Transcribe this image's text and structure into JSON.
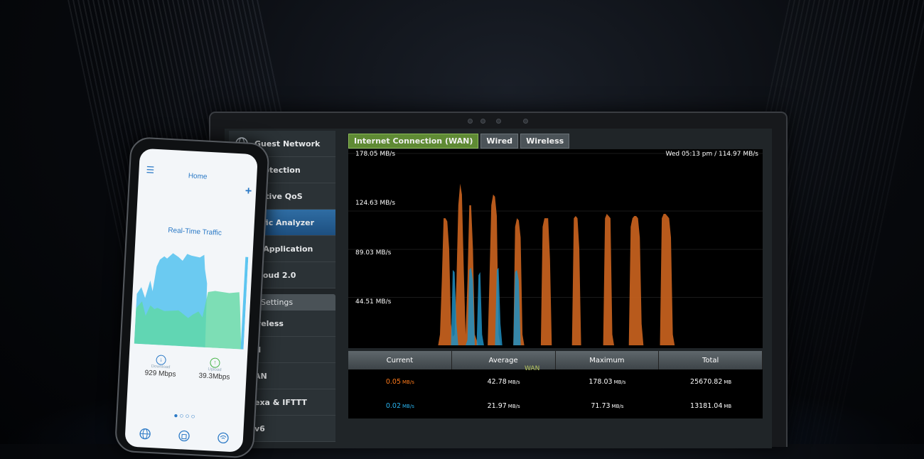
{
  "laptop": {
    "menu": {
      "items": [
        {
          "label": "Guest Network",
          "icon": "globe-users-icon",
          "active": false
        },
        {
          "label": "Protection",
          "icon": "shield-icon",
          "active": false
        },
        {
          "label": "aptive QoS",
          "icon": "qos-icon",
          "active": false
        },
        {
          "label": "affic Analyzer",
          "icon": "analyzer-icon",
          "active": true
        },
        {
          "label": "B Application",
          "icon": "usb-icon",
          "active": false
        },
        {
          "label": "Cloud 2.0",
          "icon": "cloud-icon",
          "active": false
        }
      ],
      "advanced_header": "anced Settings",
      "advanced_items": [
        "ireless",
        "N",
        "AN",
        "exa & IFTTT",
        "v6"
      ]
    },
    "tabs": [
      {
        "label": "Internet Connection (WAN)",
        "active": true
      },
      {
        "label": "Wired",
        "active": false
      },
      {
        "label": "Wireless",
        "active": false
      }
    ],
    "timestamp": "Wed 05:13 pm / 114.97 MB/s",
    "stats": {
      "headers": [
        "Current",
        "Average",
        "Maximum",
        "Total"
      ],
      "overlay_label": "WAN",
      "rows": [
        {
          "color": "#ff7a1a",
          "current": "0.05",
          "average": "42.78",
          "maximum": "178.03",
          "total": "25670.82"
        },
        {
          "color": "#29b4f0",
          "current": "0.02",
          "average": "21.97",
          "maximum": "71.73",
          "total": "13181.04"
        }
      ],
      "rate_unit": "MB/s",
      "total_unit": "MB"
    }
  },
  "chart_data": {
    "type": "area",
    "y_tick_labels": [
      "178.05 MB/s",
      "124.63 MB/s",
      "89.03 MB/s",
      "44.51 MB/s"
    ],
    "ylim": [
      0,
      178.05
    ],
    "series": [
      {
        "color": "#c8621e",
        "values": [
          0,
          0,
          0,
          0,
          0,
          0,
          0,
          0,
          0,
          0,
          0,
          0,
          0,
          0,
          0,
          0,
          0,
          0,
          0,
          0,
          0,
          0,
          0,
          0,
          0,
          0,
          0,
          0,
          0,
          0,
          0,
          0,
          0,
          0,
          0,
          0,
          0,
          0,
          0,
          0,
          0,
          0,
          0,
          0,
          0,
          0,
          0,
          0,
          0,
          0,
          10,
          60,
          118,
          118,
          115,
          90,
          20,
          8,
          10,
          60,
          130,
          150,
          140,
          70,
          10,
          60,
          130,
          130,
          90,
          10,
          5,
          0,
          0,
          0,
          0,
          0,
          0,
          60,
          130,
          140,
          138,
          120,
          10,
          0,
          0,
          0,
          0,
          0,
          0,
          0,
          0,
          110,
          118,
          116,
          100,
          10,
          0,
          0,
          0,
          0,
          0,
          0,
          0,
          0,
          0,
          0,
          110,
          118,
          118,
          118,
          80,
          0,
          0,
          0,
          0,
          0,
          0,
          0,
          0,
          0,
          0,
          0,
          0,
          118,
          120,
          118,
          90,
          0,
          0,
          0,
          0,
          0,
          0,
          0,
          0,
          0,
          0,
          0,
          0,
          0,
          118,
          122,
          120,
          118,
          10,
          0,
          0,
          0,
          0,
          0,
          0,
          0,
          0,
          0,
          110,
          118,
          120,
          120,
          118,
          100,
          20,
          0,
          0,
          0,
          0,
          0,
          0,
          0,
          0,
          0,
          0,
          118,
          122,
          122,
          120,
          118,
          100,
          10,
          0,
          0,
          0,
          0,
          0,
          0,
          0,
          0,
          0,
          0,
          0,
          0,
          0,
          0,
          0,
          0,
          0,
          0,
          0,
          0,
          0,
          0,
          0,
          0,
          0,
          0,
          0,
          0,
          0,
          0,
          0,
          0,
          0,
          0,
          0,
          0,
          0,
          0,
          0,
          0,
          0,
          0,
          0,
          0,
          0,
          0,
          0,
          0,
          0
        ]
      },
      {
        "color": "#1e8fc2",
        "values": [
          0,
          0,
          0,
          0,
          0,
          0,
          0,
          0,
          0,
          0,
          0,
          0,
          0,
          0,
          0,
          0,
          0,
          0,
          0,
          0,
          0,
          0,
          0,
          0,
          0,
          0,
          0,
          0,
          0,
          0,
          0,
          0,
          0,
          0,
          0,
          0,
          0,
          0,
          0,
          0,
          0,
          0,
          0,
          0,
          0,
          0,
          0,
          0,
          0,
          0,
          0,
          0,
          0,
          0,
          0,
          0,
          0,
          70,
          68,
          20,
          0,
          0,
          0,
          0,
          0,
          5,
          70,
          72,
          60,
          0,
          0,
          65,
          68,
          10,
          0,
          0,
          0,
          0,
          0,
          0,
          0,
          70,
          72,
          20,
          0,
          0,
          0,
          0,
          0,
          0,
          0,
          68,
          70,
          60,
          0,
          0,
          0,
          0,
          0,
          0,
          0,
          0,
          0,
          0,
          0,
          0,
          0,
          0,
          0,
          0,
          0,
          0,
          0,
          0,
          0,
          0,
          0,
          0,
          0,
          0,
          0,
          0,
          0,
          0,
          0,
          0,
          0,
          0,
          0,
          0,
          0,
          0,
          0,
          0,
          0,
          0,
          0,
          0,
          0,
          0,
          0,
          0,
          0,
          0,
          0,
          0,
          0,
          0,
          0,
          0,
          0,
          0,
          0,
          0,
          0,
          0,
          0,
          0,
          0,
          0,
          0,
          0,
          0,
          0,
          0,
          0,
          0,
          0,
          0,
          0,
          0,
          0,
          0,
          0,
          0,
          0,
          0,
          0,
          0,
          0,
          0,
          0,
          0,
          0,
          0,
          0,
          0,
          0,
          0,
          0,
          0,
          0,
          0,
          0,
          0,
          0,
          0,
          0,
          0,
          0,
          0,
          0,
          0,
          0,
          0,
          0,
          0,
          0,
          0,
          0,
          0,
          0,
          0,
          0,
          0,
          0,
          0,
          0,
          0,
          0,
          0,
          0,
          0
        ]
      }
    ]
  },
  "phone": {
    "title": "Home",
    "section_title": "Real-Time Traffic",
    "download": {
      "label": "Download",
      "value": "929 Mbps"
    },
    "upload": {
      "label": "Upload",
      "value": "39.3Mbps"
    }
  }
}
